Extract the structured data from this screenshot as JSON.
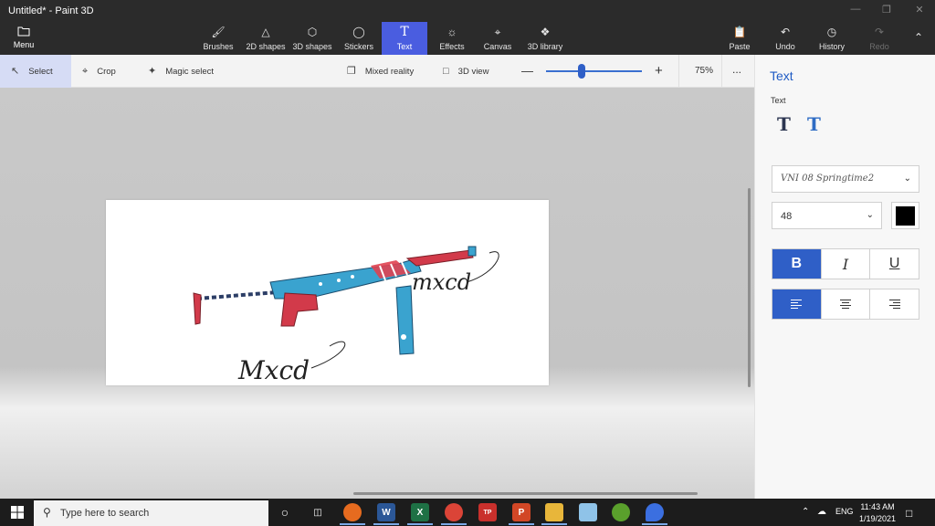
{
  "window": {
    "title": "Untitled* - Paint 3D"
  },
  "ribbon": {
    "menu_label": "Menu",
    "tools": [
      "Brushes",
      "2D shapes",
      "3D shapes",
      "Stickers",
      "Text",
      "Effects",
      "Canvas",
      "3D library"
    ],
    "active_tool": "Text",
    "right_tools": [
      "Paste",
      "Undo",
      "History",
      "Redo"
    ]
  },
  "toolbar": {
    "select_label": "Select",
    "crop_label": "Crop",
    "magic_select_label": "Magic select",
    "mixed_reality_label": "Mixed reality",
    "view3d_label": "3D view",
    "zoom_value": "75%",
    "zoom_level": 0.33,
    "more_label": "..."
  },
  "canvas": {
    "text_caption_1": "mxcd",
    "text_caption_2": "Mxcd"
  },
  "panel": {
    "title": "Text",
    "subtitle": "Text",
    "font_value": "VNI 08 Springtime2",
    "size_value": "48",
    "color": "#000000",
    "bold_label": "B",
    "italic_label": "I",
    "underline_label": "U"
  },
  "taskbar": {
    "search_placeholder": "Type here to search",
    "language": "ENG",
    "time": "11:43 AM",
    "date": "1/19/2021"
  }
}
